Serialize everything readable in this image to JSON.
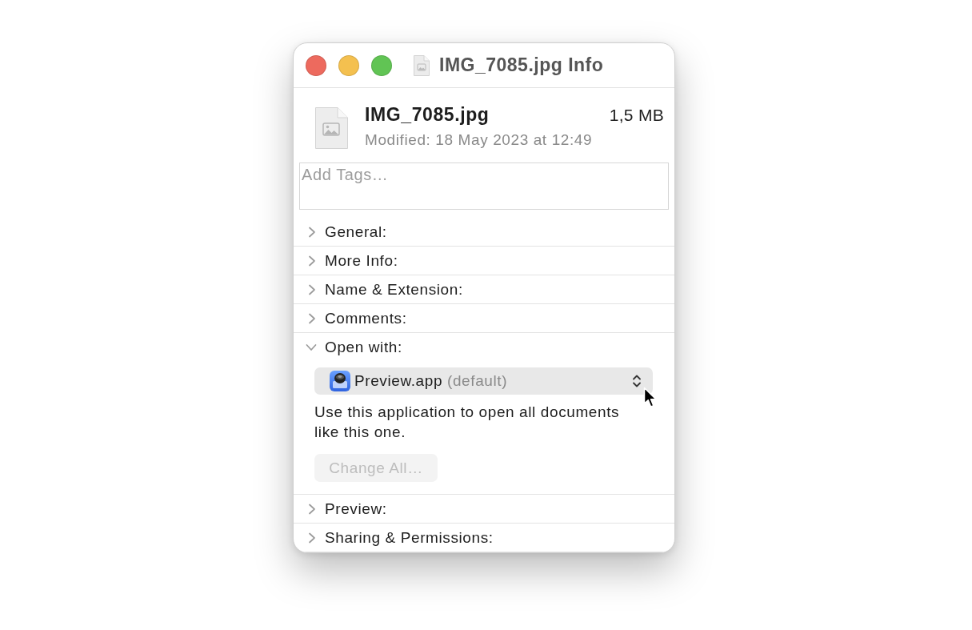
{
  "window": {
    "title": "IMG_7085.jpg Info"
  },
  "file": {
    "name": "IMG_7085.jpg",
    "size": "1,5 MB",
    "modified": "Modified: 18 May 2023 at 12:49"
  },
  "tags": {
    "placeholder": "Add Tags…"
  },
  "sections": [
    {
      "label": "General:",
      "expanded": false
    },
    {
      "label": "More Info:",
      "expanded": false
    },
    {
      "label": "Name & Extension:",
      "expanded": false
    },
    {
      "label": "Comments:",
      "expanded": false
    },
    {
      "label": "Open with:",
      "expanded": true,
      "content": {
        "app": "Preview.app",
        "note": "(default)",
        "description": "Use this application to open all documents like this one.",
        "button": {
          "label": "Change All…",
          "disabled": true
        }
      }
    },
    {
      "label": "Preview:",
      "expanded": false
    },
    {
      "label": "Sharing & Permissions:",
      "expanded": false
    }
  ]
}
